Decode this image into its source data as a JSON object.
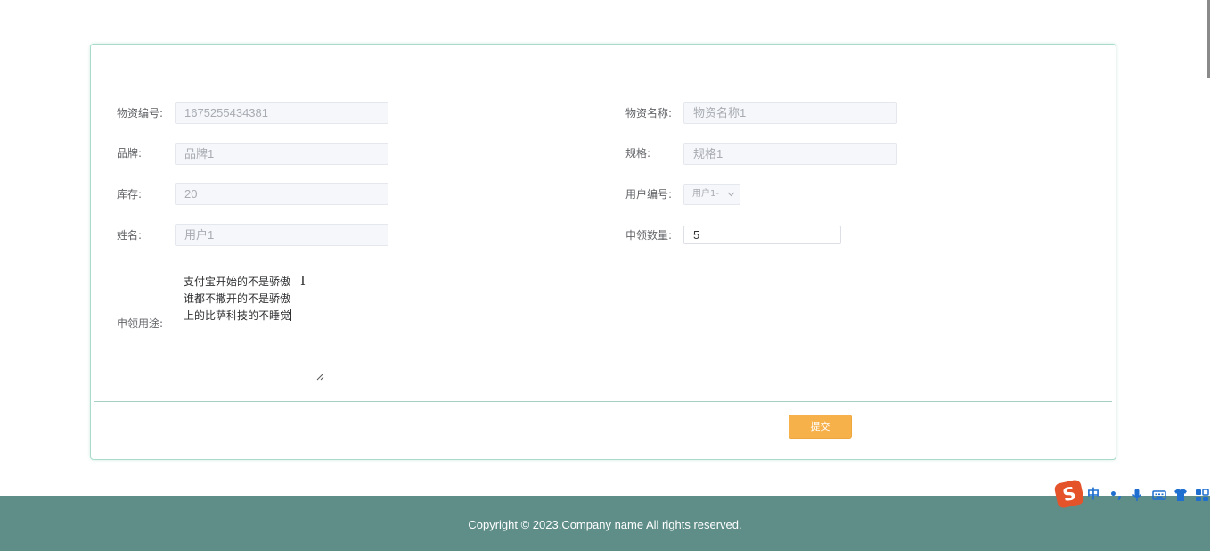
{
  "form": {
    "fields": {
      "material_no": {
        "label": "物资编号:",
        "value": "1675255434381"
      },
      "material_name": {
        "label": "物资名称:",
        "value": "物资名称1"
      },
      "brand": {
        "label": "品牌:",
        "value": "品牌1"
      },
      "spec": {
        "label": "规格:",
        "value": "规格1"
      },
      "stock": {
        "label": "库存:",
        "value": "20"
      },
      "user_no": {
        "label": "用户编号:",
        "value": "用户1-"
      },
      "name": {
        "label": "姓名:",
        "value": "用户1"
      },
      "apply_qty": {
        "label": "申领数量:",
        "value": "5"
      },
      "purpose": {
        "label": "申领用途:",
        "lines": [
          "支付宝开始的不是骄傲",
          "谁都不撒开的不是骄傲",
          "上的比萨科技的不睡觉"
        ]
      }
    },
    "submit_label": "提交"
  },
  "footer": {
    "copyright": "Copyright © 2023.Company name All rights reserved."
  },
  "ime_toolbar": {
    "logo": "S",
    "mode": "中",
    "punct": "•,",
    "icons": [
      "microphone-icon",
      "keyboard-icon",
      "skin-icon",
      "toolbox-icon"
    ]
  },
  "colors": {
    "card_border": "#a9dcc8",
    "submit": "#f6b14b",
    "footer": "#5f8e89"
  }
}
